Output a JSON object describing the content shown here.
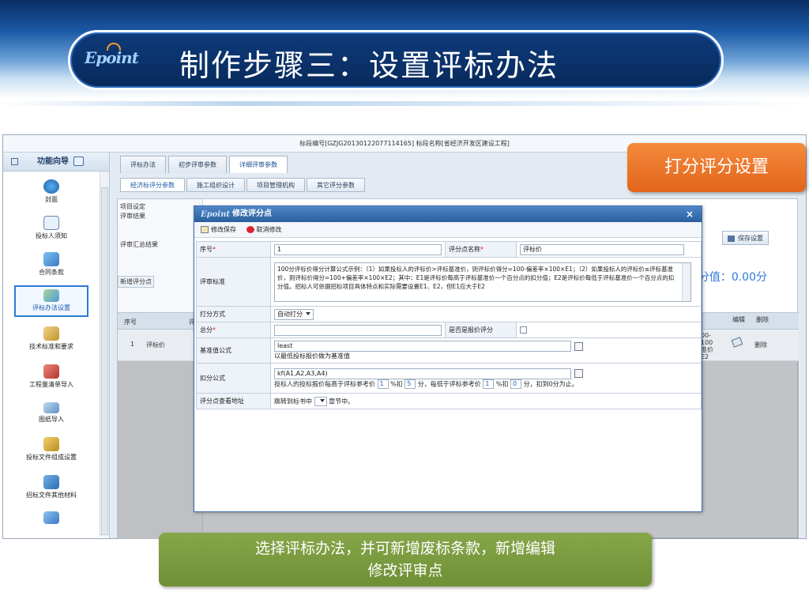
{
  "slide": {
    "logo": "Epoint",
    "title": "制作步骤三：设置评标办法"
  },
  "app": {
    "header": "标段编号[GZJG20130122077114165]  标段名称[省经济开发区建设工程]",
    "sidebar": {
      "title": "功能向导",
      "items": [
        {
          "label": "封面",
          "icon": "globe-icon"
        },
        {
          "label": "投标人须知",
          "icon": "document-user-icon"
        },
        {
          "label": "合同条款",
          "icon": "contract-icon"
        },
        {
          "label": "评标办法设置",
          "icon": "evaluation-icon"
        },
        {
          "label": "技术标准和要求",
          "icon": "tools-icon"
        },
        {
          "label": "工程量清单导入",
          "icon": "book-icon"
        },
        {
          "label": "图纸导入",
          "icon": "drawing-icon"
        },
        {
          "label": "投标文件组成设置",
          "icon": "bag-icon"
        },
        {
          "label": "招标文件其他材料",
          "icon": "materials-icon"
        }
      ]
    },
    "tabs": [
      "评标办法",
      "初步评审参数",
      "详细评审参数"
    ],
    "subtabs": [
      "经济标评分参数",
      "施工组织设计",
      "项目管理机构",
      "其它评分参数"
    ],
    "panel": {
      "section": "项目设定",
      "review_result": "评审结果",
      "review_summary": "评审汇总结果",
      "add_point": "新增评分点",
      "col_no": "序号",
      "col_name": "评",
      "row_no": "1",
      "row_name": "评标价",
      "save_button": "保存设置",
      "score_value": "分值：0.00分",
      "col_edit": "编辑",
      "col_delete": "删除",
      "row_partial": "00-\n100\n准价\nE2",
      "row_delete": "删除"
    },
    "modal": {
      "logo": "Epoint",
      "title": "修改评分点",
      "close": "×",
      "save": "修改保存",
      "cancel": "取消修改",
      "fields": {
        "seq_label": "序号",
        "seq_value": "1",
        "name_label": "评分点名称",
        "name_value": "评标价",
        "criteria_label": "评审标准",
        "criteria_text": "100分评标价得分计算公式示例：（1）如果投标人的评标价>评标基准价，则评标价得分=100-偏差率×100×E1；（2）如果投标人的评标价≤评标基准价，则评标价得分=100+偏差率×100×E2；其中：E1是评标价每高于评标基准价一个百分点的扣分值；E2是评标价每低于评标基准价一个百分点的扣分值。招标人可依据招标项目具体特点和实际需要设置E1、E2，但E1应大于E2",
        "method_label": "打分方式",
        "method_value": "自动打分",
        "total_label": "总分",
        "total_value": "",
        "is_quote_label": "是否是报价评分",
        "base_formula_label": "基准值公式",
        "base_formula_value": "least",
        "base_formula_desc": "以最低投标报价做为基准值",
        "deduct_label": "扣分公式",
        "deduct_formula": "kf(A1,A2,A3,A4)",
        "deduct_t1": "投标人的投标报价每高于评标参考价",
        "deduct_v1": "1",
        "deduct_t2": "%扣",
        "deduct_v2": "5",
        "deduct_t3": "分，每低于评标参考价",
        "deduct_v3": "1",
        "deduct_t4": "%扣",
        "deduct_v4": "0",
        "deduct_t5": "分，扣到0分为止。",
        "lookup_label": "评分点查看地址",
        "lookup_t1": "跳转到标书中",
        "lookup_t2": "章节中。"
      }
    }
  },
  "callouts": {
    "orange": "打分评分设置",
    "green_line1": "选择评标办法，并可新增废标条款，新增编辑",
    "green_line2": "修改评审点"
  }
}
